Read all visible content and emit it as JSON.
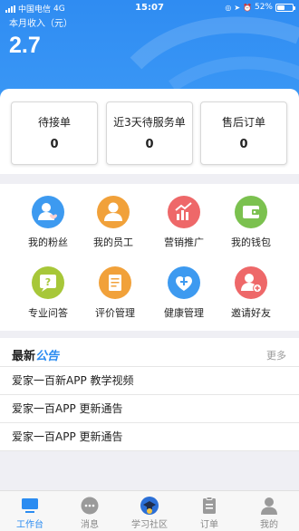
{
  "status_bar": {
    "carrier": "中国电信",
    "network": "4G",
    "time": "15:07",
    "battery_text": "52%",
    "battery_level": 0.52
  },
  "header": {
    "income_label": "本月收入（元）",
    "income_value": "2.7"
  },
  "orders": [
    {
      "title": "待接单",
      "count": "0"
    },
    {
      "title": "近3天待服务单",
      "count": "0"
    },
    {
      "title": "售后订单",
      "count": "0"
    }
  ],
  "menu": [
    {
      "label": "我的粉丝",
      "icon": "fans-icon",
      "color": "#3d9af0"
    },
    {
      "label": "我的员工",
      "icon": "staff-icon",
      "color": "#f1a13a"
    },
    {
      "label": "营销推广",
      "icon": "marketing-icon",
      "color": "#ee6869"
    },
    {
      "label": "我的钱包",
      "icon": "wallet-icon",
      "color": "#7bc14f"
    },
    {
      "label": "专业问答",
      "icon": "qa-icon",
      "color": "#a7c739"
    },
    {
      "label": "评价管理",
      "icon": "review-icon",
      "color": "#f1a13a"
    },
    {
      "label": "健康管理",
      "icon": "health-icon",
      "color": "#3d9af0"
    },
    {
      "label": "邀请好友",
      "icon": "invite-icon",
      "color": "#ee6869"
    }
  ],
  "notice": {
    "title_part1": "最新",
    "title_part2": "公告",
    "more": "更多",
    "items": [
      "爱家一百新APP 教学视频",
      "爱家一百APP 更新通告",
      "爱家一百APP 更新通告"
    ]
  },
  "tabs": [
    {
      "label": "工作台",
      "icon": "workbench-icon",
      "active": true
    },
    {
      "label": "消息",
      "icon": "message-icon",
      "active": false
    },
    {
      "label": "学习社区",
      "icon": "community-icon",
      "active": false
    },
    {
      "label": "订单",
      "icon": "order-icon",
      "active": false
    },
    {
      "label": "我的",
      "icon": "profile-icon",
      "active": false
    }
  ],
  "colors": {
    "primary": "#2b8cf1",
    "header_bg": "#2f8cf2"
  }
}
